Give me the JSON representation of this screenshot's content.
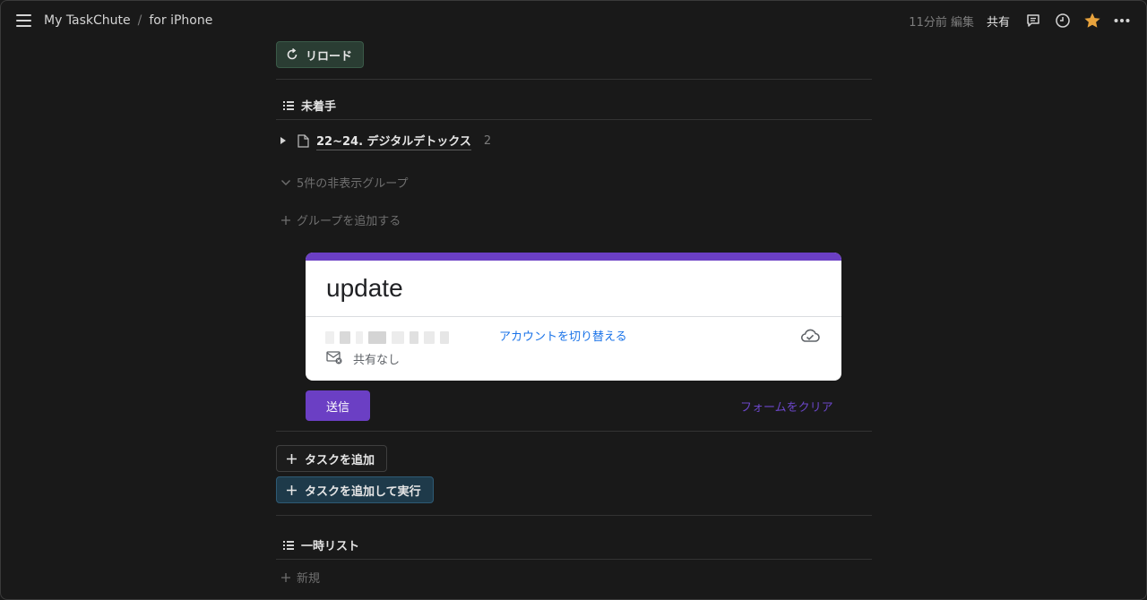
{
  "topbar": {
    "breadcrumb": [
      "My TaskChute",
      "for iPhone"
    ],
    "breadcrumb_sep": "/",
    "edited": "11分前 編集",
    "share": "共有",
    "icons": [
      "comment-icon",
      "clock-icon",
      "star-icon",
      "more-icon"
    ],
    "star_color": "#e8a33d"
  },
  "reload": {
    "label": "リロード"
  },
  "not_started": {
    "title": "未着手",
    "group": {
      "name": "22~24. デジタルデトックス",
      "count": "2"
    },
    "hidden_groups": "5件の非表示グループ",
    "add_group": "グループを追加する"
  },
  "form": {
    "title": "update",
    "switch_account": "アカウントを切り替える",
    "not_shared": "共有なし",
    "submit": "送信",
    "clear": "フォームをクリア",
    "accent": "#6b3fc4"
  },
  "actions": {
    "add_task": "タスクを追加",
    "add_task_run": "タスクを追加して実行"
  },
  "temp_list": {
    "title": "一時リスト",
    "new": "新規"
  }
}
